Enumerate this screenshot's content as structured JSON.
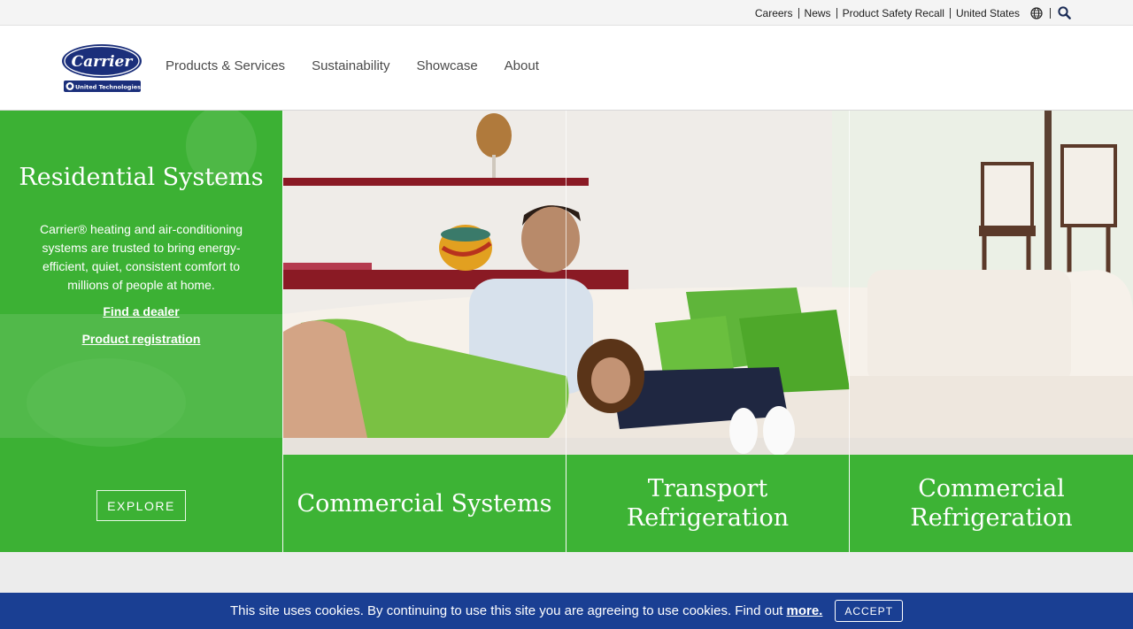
{
  "utility": {
    "links": [
      "Careers",
      "News",
      "Product Safety Recall",
      "United States"
    ],
    "globe_icon": "globe-icon",
    "search_icon": "search-icon"
  },
  "header": {
    "logo_text": "Carrier",
    "logo_subtext": "United Technologies",
    "nav": [
      "Products & Services",
      "Sustainability",
      "Showcase",
      "About"
    ]
  },
  "hero": {
    "residential": {
      "title": "Residential Systems",
      "description": "Carrier® heating and air-conditioning systems are trusted to bring energy-efficient, quiet, consistent comfort to millions of people at home.",
      "link_dealer": "Find a dealer",
      "link_registration": "Product registration",
      "explore": "EXPLORE"
    },
    "tiles": [
      "Commercial Systems",
      "Transport Refrigeration",
      "Commercial Refrigeration"
    ]
  },
  "cookie": {
    "message": "This site uses cookies. By continuing to use this site you are agreeing to use cookies. Find out",
    "more": "more.",
    "accept": "ACCEPT"
  },
  "colors": {
    "brand_green": "#3cb134",
    "cookie_blue": "#1a3f93",
    "logo_navy": "#1b2f7b"
  }
}
